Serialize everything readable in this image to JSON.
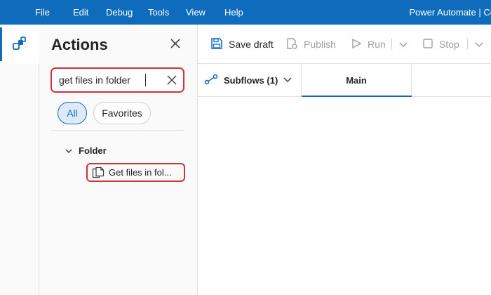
{
  "menu": {
    "items": [
      "File",
      "Edit",
      "Debug",
      "Tools",
      "View",
      "Help"
    ],
    "app_title": "Power Automate | Co"
  },
  "actions_pane": {
    "title": "Actions",
    "search_value": "get files in folder",
    "filters": {
      "all": "All",
      "favorites": "Favorites"
    },
    "tree": {
      "folder_label": "Folder",
      "action_label": "Get files in fol..."
    }
  },
  "toolbar": {
    "save_draft": "Save draft",
    "publish": "Publish",
    "run": "Run",
    "stop": "Stop"
  },
  "tabs": {
    "subflows": "Subflows (1)",
    "main": "Main"
  },
  "colors": {
    "accent": "#0f6cbd",
    "highlight": "#d13438"
  }
}
